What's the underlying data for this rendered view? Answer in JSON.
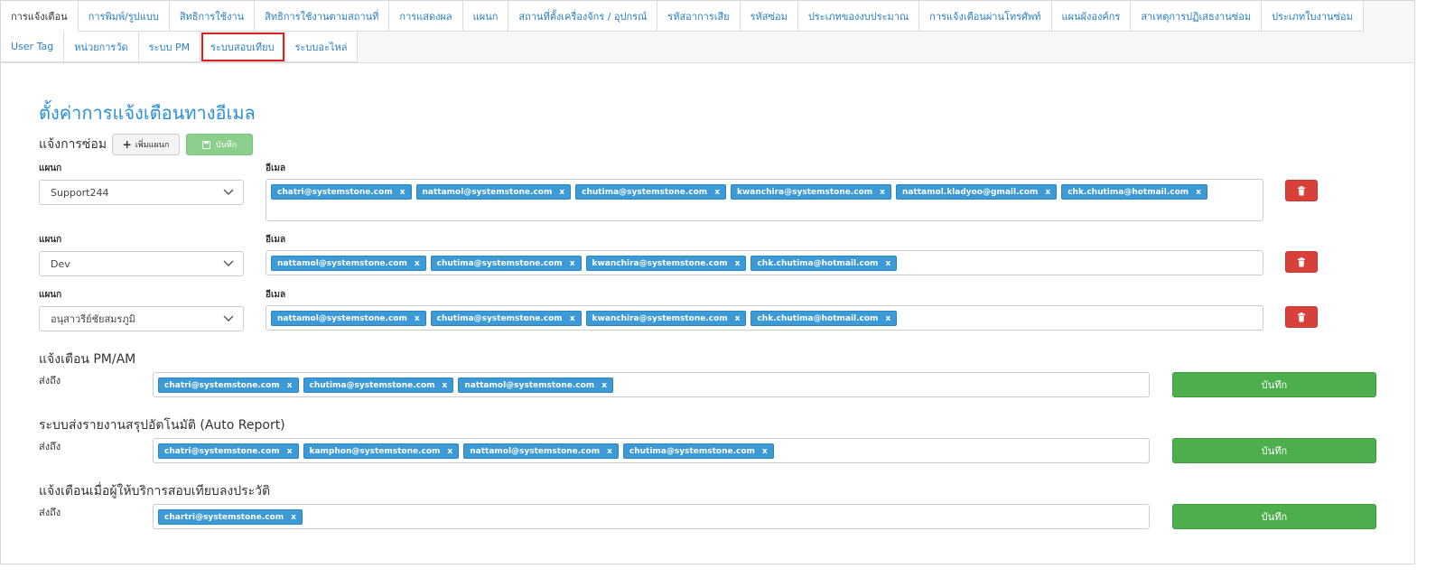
{
  "tabs": [
    {
      "label": "การแจ้งเตือน",
      "active": true
    },
    {
      "label": "การพิมพ์/รูปแบบ"
    },
    {
      "label": "สิทธิการใช้งาน"
    },
    {
      "label": "สิทธิการใช้งานตามสถานที่"
    },
    {
      "label": "การแสดงผล"
    },
    {
      "label": "แผนก"
    },
    {
      "label": "สถานที่ตั้งเครื่องจักร / อุปกรณ์"
    },
    {
      "label": "รหัสอาการเสีย"
    },
    {
      "label": "รหัสซ่อม"
    },
    {
      "label": "ประเภทของงบประมาณ"
    },
    {
      "label": "การแจ้งเตือนผ่านโทรศัพท์"
    },
    {
      "label": "แผนผังองค์กร"
    },
    {
      "label": "สาเหตุการปฏิเสธงานซ่อม"
    },
    {
      "label": "ประเภทใบงานซ่อม"
    },
    {
      "label": "User Tag"
    },
    {
      "label": "หน่วยการวัด"
    },
    {
      "label": "ระบบ PM"
    },
    {
      "label": "ระบบสอบเทียบ",
      "highlighted": true
    },
    {
      "label": "ระบบอะไหล่"
    }
  ],
  "page": {
    "title": "ตั้งค่าการแจ้งเตือนทางอีเมล",
    "repair_heading": "แจ้งการซ่อม",
    "add_department_label": "เพิ่มแผนก",
    "save_label_small": "บันทึก",
    "department_label": "แผนก",
    "email_label": "อีเมล",
    "recipient_label": "ส่งถึง",
    "save_label": "บันทึก"
  },
  "repair_rows": [
    {
      "department": "Support244",
      "emails": [
        "chatri@systemstone.com",
        "nattamol@systemstone.com",
        "chutima@systemstone.com",
        "kwanchira@systemstone.com",
        "nattamol.kladyoo@gmail.com",
        "chk.chutima@hotmail.com"
      ]
    },
    {
      "department": "Dev",
      "emails": [
        "nattamol@systemstone.com",
        "chutima@systemstone.com",
        "kwanchira@systemstone.com",
        "chk.chutima@hotmail.com"
      ]
    },
    {
      "department": "อนุสาวรีย์ชัยสมรภูมิ",
      "emails": [
        "nattamol@systemstone.com",
        "chutima@systemstone.com",
        "kwanchira@systemstone.com",
        "chk.chutima@hotmail.com"
      ]
    }
  ],
  "notify_sections": [
    {
      "heading": "แจ้งเตือน PM/AM",
      "emails": [
        "chatri@systemstone.com",
        "chutima@systemstone.com",
        "nattamol@systemstone.com"
      ]
    },
    {
      "heading": "ระบบส่งรายงานสรุปอัตโนมัติ (Auto Report)",
      "emails": [
        "chatri@systemstone.com",
        "kamphon@systemstone.com",
        "nattamol@systemstone.com",
        "chutima@systemstone.com"
      ]
    },
    {
      "heading": "แจ้งเตือนเมื่อผู้ให้บริการสอบเทียบลงประวัติ",
      "emails": [
        "chartri@systemstone.com"
      ]
    }
  ],
  "tag_remove_glyph": "x",
  "colors": {
    "title": "#2a90d8",
    "tag": "#3c9ad6",
    "save": "#4cae4c",
    "delete": "#d9403a",
    "highlight": "#e02020"
  }
}
